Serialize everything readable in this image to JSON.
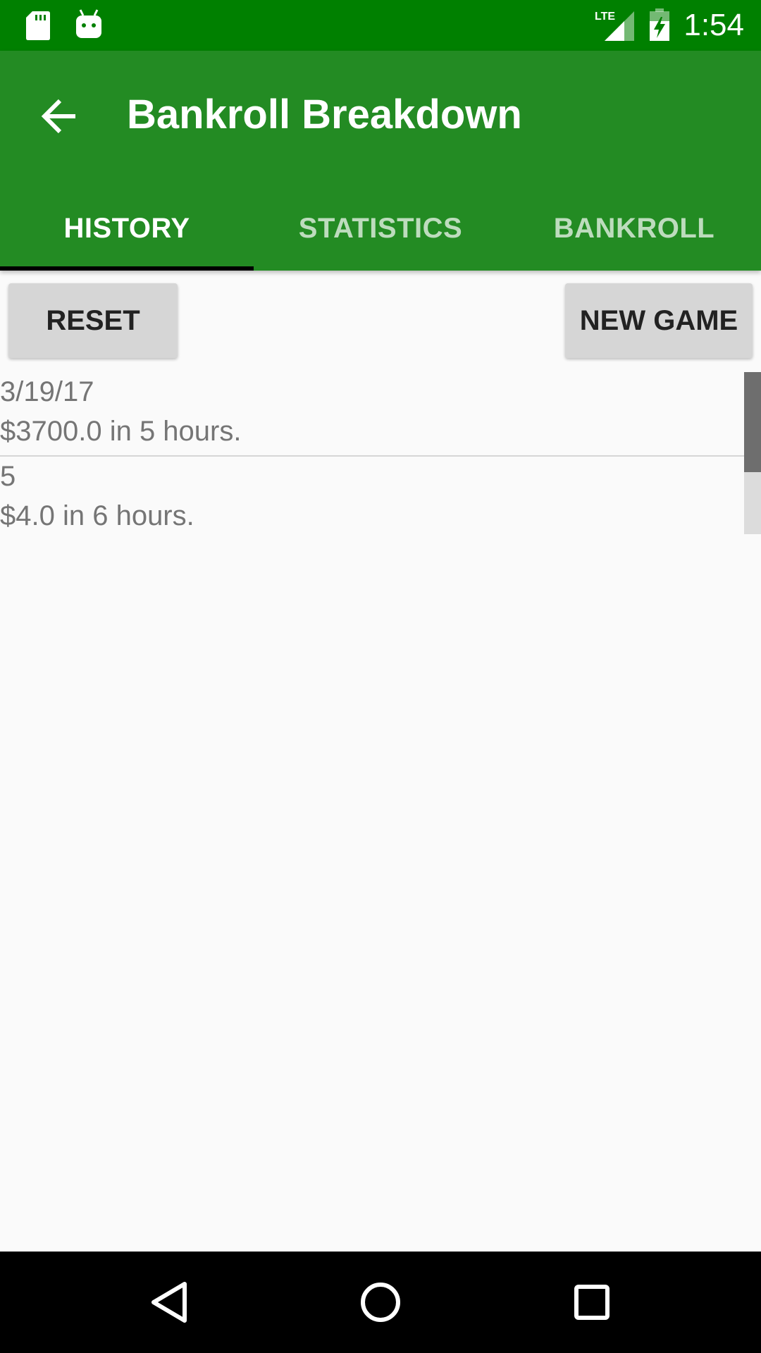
{
  "status_bar": {
    "time": "1:54",
    "network": "LTE",
    "icons": [
      "sd-card-icon",
      "android-debug-icon",
      "lte-signal-icon",
      "battery-charging-icon"
    ]
  },
  "app_bar": {
    "title": "Bankroll Breakdown",
    "back_icon": "arrow-left-icon",
    "color": "#238b23"
  },
  "tabs": [
    {
      "label": "HISTORY",
      "active": true
    },
    {
      "label": "STATISTICS",
      "active": false
    },
    {
      "label": "BANKROLL",
      "active": false
    }
  ],
  "actions": {
    "reset_label": "RESET",
    "new_game_label": "NEW GAME"
  },
  "history": [
    {
      "title": "3/19/17",
      "summary": "$3700.0 in 5 hours."
    },
    {
      "title": "5",
      "summary": "$4.0 in 6 hours."
    }
  ],
  "nav_bar": {
    "icons": [
      "back-triangle-icon",
      "home-circle-icon",
      "recents-square-icon"
    ]
  }
}
